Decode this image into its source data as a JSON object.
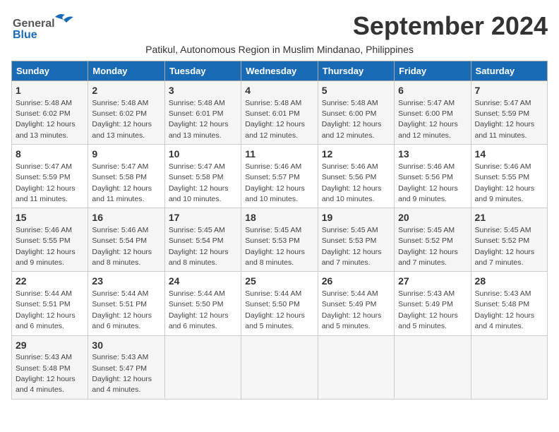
{
  "logo": {
    "line1": "General",
    "line2": "Blue"
  },
  "title": "September 2024",
  "subtitle": "Patikul, Autonomous Region in Muslim Mindanao, Philippines",
  "days_of_week": [
    "Sunday",
    "Monday",
    "Tuesday",
    "Wednesday",
    "Thursday",
    "Friday",
    "Saturday"
  ],
  "weeks": [
    [
      {
        "day": 1,
        "sunrise": "5:48 AM",
        "sunset": "6:02 PM",
        "daylight": "12 hours and 13 minutes."
      },
      {
        "day": 2,
        "sunrise": "5:48 AM",
        "sunset": "6:02 PM",
        "daylight": "12 hours and 13 minutes."
      },
      {
        "day": 3,
        "sunrise": "5:48 AM",
        "sunset": "6:01 PM",
        "daylight": "12 hours and 13 minutes."
      },
      {
        "day": 4,
        "sunrise": "5:48 AM",
        "sunset": "6:01 PM",
        "daylight": "12 hours and 12 minutes."
      },
      {
        "day": 5,
        "sunrise": "5:48 AM",
        "sunset": "6:00 PM",
        "daylight": "12 hours and 12 minutes."
      },
      {
        "day": 6,
        "sunrise": "5:47 AM",
        "sunset": "6:00 PM",
        "daylight": "12 hours and 12 minutes."
      },
      {
        "day": 7,
        "sunrise": "5:47 AM",
        "sunset": "5:59 PM",
        "daylight": "12 hours and 11 minutes."
      }
    ],
    [
      {
        "day": 8,
        "sunrise": "5:47 AM",
        "sunset": "5:59 PM",
        "daylight": "12 hours and 11 minutes."
      },
      {
        "day": 9,
        "sunrise": "5:47 AM",
        "sunset": "5:58 PM",
        "daylight": "12 hours and 11 minutes."
      },
      {
        "day": 10,
        "sunrise": "5:47 AM",
        "sunset": "5:58 PM",
        "daylight": "12 hours and 10 minutes."
      },
      {
        "day": 11,
        "sunrise": "5:46 AM",
        "sunset": "5:57 PM",
        "daylight": "12 hours and 10 minutes."
      },
      {
        "day": 12,
        "sunrise": "5:46 AM",
        "sunset": "5:56 PM",
        "daylight": "12 hours and 10 minutes."
      },
      {
        "day": 13,
        "sunrise": "5:46 AM",
        "sunset": "5:56 PM",
        "daylight": "12 hours and 9 minutes."
      },
      {
        "day": 14,
        "sunrise": "5:46 AM",
        "sunset": "5:55 PM",
        "daylight": "12 hours and 9 minutes."
      }
    ],
    [
      {
        "day": 15,
        "sunrise": "5:46 AM",
        "sunset": "5:55 PM",
        "daylight": "12 hours and 9 minutes."
      },
      {
        "day": 16,
        "sunrise": "5:46 AM",
        "sunset": "5:54 PM",
        "daylight": "12 hours and 8 minutes."
      },
      {
        "day": 17,
        "sunrise": "5:45 AM",
        "sunset": "5:54 PM",
        "daylight": "12 hours and 8 minutes."
      },
      {
        "day": 18,
        "sunrise": "5:45 AM",
        "sunset": "5:53 PM",
        "daylight": "12 hours and 8 minutes."
      },
      {
        "day": 19,
        "sunrise": "5:45 AM",
        "sunset": "5:53 PM",
        "daylight": "12 hours and 7 minutes."
      },
      {
        "day": 20,
        "sunrise": "5:45 AM",
        "sunset": "5:52 PM",
        "daylight": "12 hours and 7 minutes."
      },
      {
        "day": 21,
        "sunrise": "5:45 AM",
        "sunset": "5:52 PM",
        "daylight": "12 hours and 7 minutes."
      }
    ],
    [
      {
        "day": 22,
        "sunrise": "5:44 AM",
        "sunset": "5:51 PM",
        "daylight": "12 hours and 6 minutes."
      },
      {
        "day": 23,
        "sunrise": "5:44 AM",
        "sunset": "5:51 PM",
        "daylight": "12 hours and 6 minutes."
      },
      {
        "day": 24,
        "sunrise": "5:44 AM",
        "sunset": "5:50 PM",
        "daylight": "12 hours and 6 minutes."
      },
      {
        "day": 25,
        "sunrise": "5:44 AM",
        "sunset": "5:50 PM",
        "daylight": "12 hours and 5 minutes."
      },
      {
        "day": 26,
        "sunrise": "5:44 AM",
        "sunset": "5:49 PM",
        "daylight": "12 hours and 5 minutes."
      },
      {
        "day": 27,
        "sunrise": "5:43 AM",
        "sunset": "5:49 PM",
        "daylight": "12 hours and 5 minutes."
      },
      {
        "day": 28,
        "sunrise": "5:43 AM",
        "sunset": "5:48 PM",
        "daylight": "12 hours and 4 minutes."
      }
    ],
    [
      {
        "day": 29,
        "sunrise": "5:43 AM",
        "sunset": "5:48 PM",
        "daylight": "12 hours and 4 minutes."
      },
      {
        "day": 30,
        "sunrise": "5:43 AM",
        "sunset": "5:47 PM",
        "daylight": "12 hours and 4 minutes."
      },
      null,
      null,
      null,
      null,
      null
    ]
  ]
}
